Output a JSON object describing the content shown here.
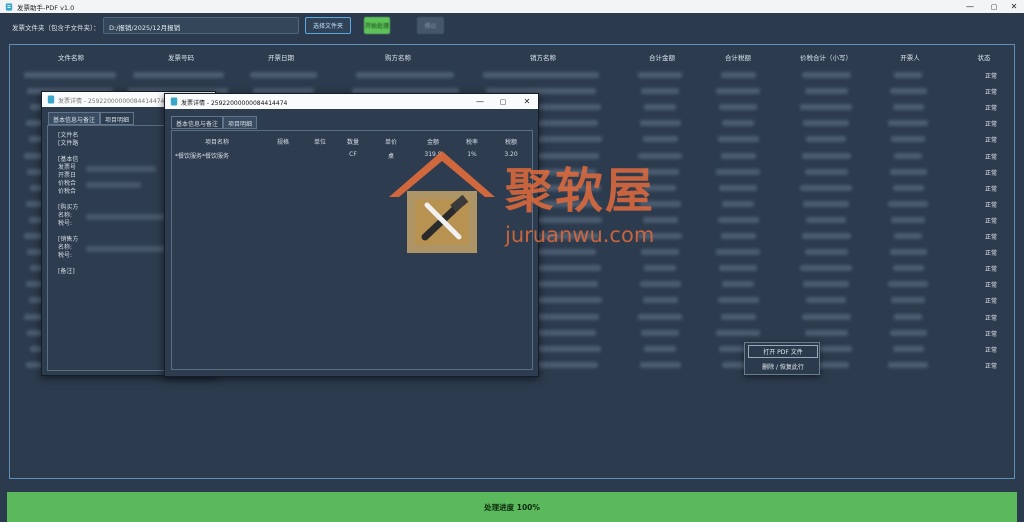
{
  "app": {
    "title": "发票助手-PDF v1.0"
  },
  "toolbar": {
    "folder_label": "发票文件夹（包含子文件夹）：",
    "folder_path": "D:/报销/2025/12月报销",
    "select_folder": "选择文件夹",
    "start": "开始处理",
    "stop": "停止"
  },
  "table": {
    "columns": [
      "文件名称",
      "发票号码",
      "开票日期",
      "购方名称",
      "销方名称",
      "合计金额",
      "合计税额",
      "价税合计（小写）",
      "开票人",
      "状态"
    ],
    "rows_status": [
      "正常",
      "正常",
      "正常",
      "正常",
      "正常",
      "正常",
      "正常",
      "正常",
      "正常",
      "正常",
      "正常",
      "正常",
      "正常",
      "正常",
      "正常",
      "正常",
      "正常",
      "正常",
      "正常"
    ]
  },
  "context_menu": {
    "open_pdf": "打开 PDF 文件",
    "delete_restore": "删除 / 恢复此行"
  },
  "progress": {
    "text": "处理进度 100%",
    "percent": 100
  },
  "dialog_back": {
    "title": "发票详情 - 25922000000084414474",
    "tabs": [
      "基本信息与备注",
      "项目明细"
    ],
    "lines": [
      "[文件名",
      "[文件路",
      "[基本信",
      "发票号",
      "开票日",
      "价税合",
      "价税合",
      "[购买方",
      "名称:",
      "税号:",
      "[销售方",
      "名称:",
      "税号:",
      "[备注]"
    ]
  },
  "dialog_front": {
    "title": "发票详情 - 25922000000084414474",
    "tabs": [
      "基本信息与备注",
      "项目明细"
    ],
    "columns": [
      "项目名称",
      "规格",
      "单位",
      "数量",
      "单价",
      "金额",
      "税率",
      "税额"
    ],
    "item": {
      "name": "*餐饮服务*餐饮服务",
      "spec": "",
      "unit": "",
      "qty": "CF",
      "price": "桌",
      "amount": "319.8",
      "rate": "1%",
      "tax": "3.20"
    }
  },
  "watermark": {
    "cn": "聚软屋",
    "en": "juruanwu.com"
  },
  "colors": {
    "accent": "#5ba9e0",
    "progress": "#5cb85c",
    "watermark": "#e36b3c",
    "background": "#2b3a4c"
  }
}
